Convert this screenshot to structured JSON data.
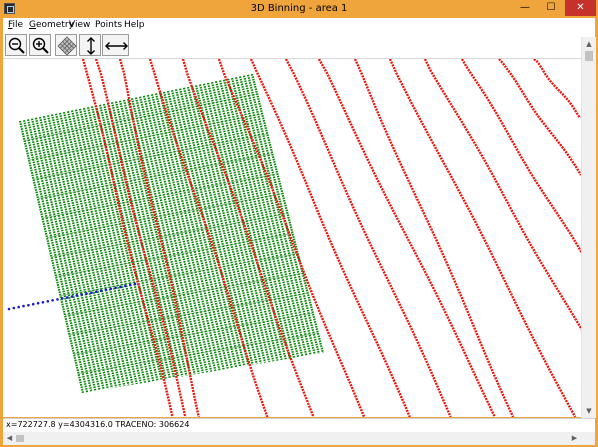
{
  "window": {
    "title": "3D Binning - area 1",
    "minimize_glyph": "—",
    "maximize_glyph": "☐",
    "close_glyph": "✕"
  },
  "menu": {
    "items": [
      {
        "label": "File",
        "accel": "F",
        "rest": "ile"
      },
      {
        "label": "Geometry",
        "accel": "G",
        "rest": "eometry"
      },
      {
        "label": "View",
        "accel": "",
        "rest": "View"
      },
      {
        "label": "Points",
        "accel": "",
        "rest": "Points"
      },
      {
        "label": "Help",
        "accel": "",
        "rest": "Help"
      }
    ]
  },
  "toolbar": {
    "buttons": [
      {
        "icon": "zoom-out-icon"
      },
      {
        "icon": "zoom-in-icon"
      },
      {
        "icon": "grid-icon"
      },
      {
        "icon": "vertical-stretch-icon"
      },
      {
        "icon": "horizontal-stretch-icon"
      }
    ]
  },
  "status": {
    "text": "x=722727.8 y=4304316.0 TRACENO: 306624"
  },
  "colors": {
    "bin_grid": "#0a8a0a",
    "receiver_lines": "#e8160c",
    "source_line": "#1a1acc",
    "titlebar": "#f0a43c",
    "close_button": "#c7312b"
  }
}
